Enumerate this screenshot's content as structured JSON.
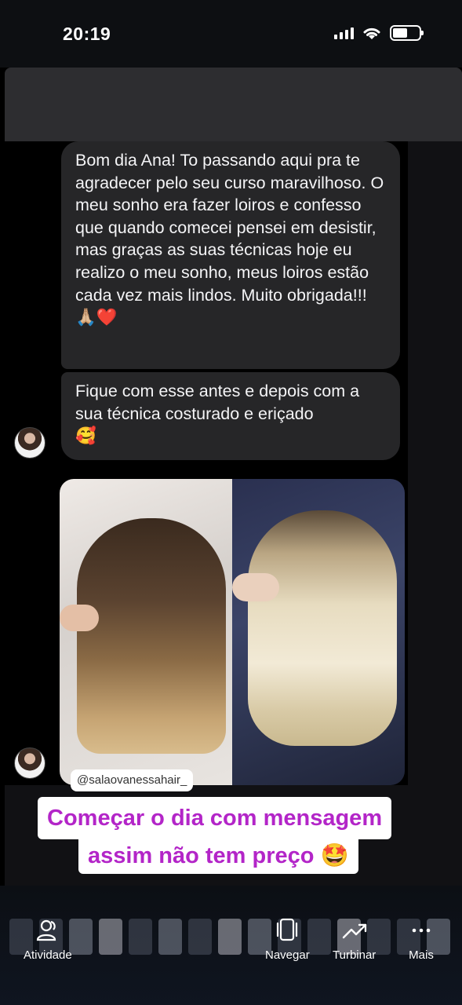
{
  "status_bar": {
    "time": "20:19"
  },
  "chat": {
    "message1": "Bom dia Ana! To passando aqui pra te agradecer pelo seu curso maravilhoso. O meu sonho era fazer loiros e confesso que quando comecei pensei em desistir, mas graças as suas técnicas hoje eu realizo o meu sonho, meus loiros estão cada vez mais lindos. Muito obrigada!!!",
    "message1_emoji": "🙏🏼❤️",
    "message2": "Fique com esse antes e depois com a sua técnica costurado e eriçado",
    "message2_emoji": "🥰"
  },
  "mention": "@salaovanessahair_",
  "caption": {
    "line1": "Começar o dia com mensagem",
    "line2": "assim não tem preço",
    "emoji": "🤩"
  },
  "bottom_nav": {
    "atividade": {
      "label": "Atividade",
      "icon": "people-icon"
    },
    "navegar": {
      "label": "Navegar",
      "icon": "phone-frame-icon"
    },
    "turbinar": {
      "label": "Turbinar",
      "icon": "trend-up-icon"
    },
    "mais": {
      "label": "Mais",
      "icon": "more-icon"
    }
  }
}
